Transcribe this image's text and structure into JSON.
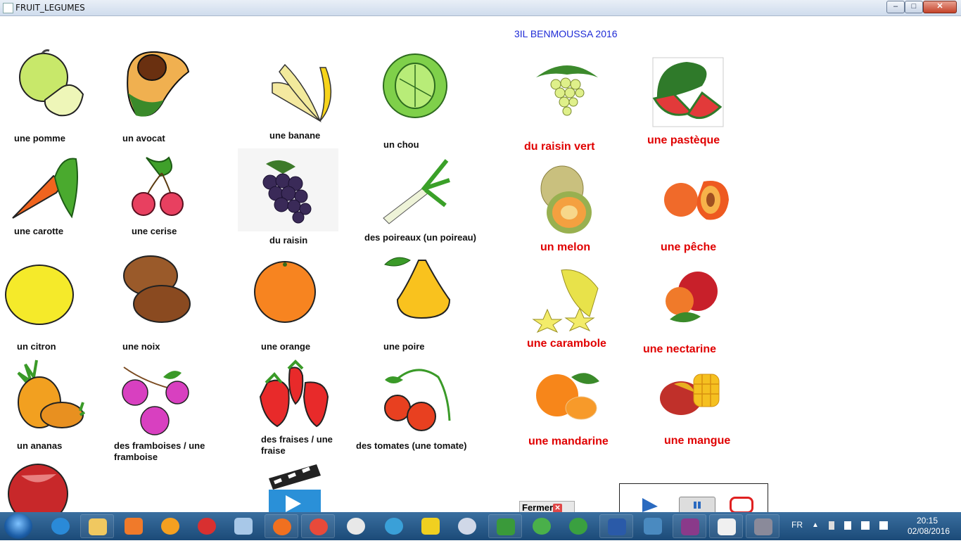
{
  "window": {
    "title": "FRUIT_LEGUMES",
    "min": "–",
    "max": "□",
    "close": "✕"
  },
  "credit": "3IL BENMOUSSA 2016",
  "items": [
    {
      "label": "une pomme"
    },
    {
      "label": "un avocat"
    },
    {
      "label": "une banane"
    },
    {
      "label": "un chou"
    },
    {
      "label": "du raisin vert"
    },
    {
      "label": "une pastèque"
    },
    {
      "label": "une carotte"
    },
    {
      "label": "une cerise"
    },
    {
      "label": "du raisin"
    },
    {
      "label": "des poireaux (un poireau)"
    },
    {
      "label": "un melon"
    },
    {
      "label": "une pêche"
    },
    {
      "label": "un citron"
    },
    {
      "label": "une noix"
    },
    {
      "label": "une orange"
    },
    {
      "label": "une poire"
    },
    {
      "label": "une carambole"
    },
    {
      "label": "une nectarine"
    },
    {
      "label": "un ananas"
    },
    {
      "label": "des framboises / une framboise"
    },
    {
      "label": "des fraises / une fraise"
    },
    {
      "label": "des tomates (une tomate)"
    },
    {
      "label": "une mandarine"
    },
    {
      "label": "une mangue"
    }
  ],
  "controls": {
    "close_label": "Fermer",
    "close_x": "✕"
  },
  "taskbar": {
    "language": "FR",
    "time": "20:15",
    "date": "02/08/2016",
    "icons": [
      "internet-explorer-icon",
      "file-explorer-icon",
      "media-player-icon",
      "gom-player-icon",
      "app-icon",
      "notepad-icon",
      "firefox-icon",
      "chrome-icon",
      "opera-icon",
      "video-icon",
      "vector-app-icon",
      "torrent-icon",
      "camtasia-icon",
      "color-app-icon",
      "utorrent-icon",
      "word-icon",
      "photos-icon",
      "winrar-icon",
      "notes-icon",
      "eiffel-icon"
    ]
  },
  "colors": {
    "label_red": "#e00000",
    "credit_blue": "#1f2bd6",
    "taskbar": "#1b4a78"
  }
}
